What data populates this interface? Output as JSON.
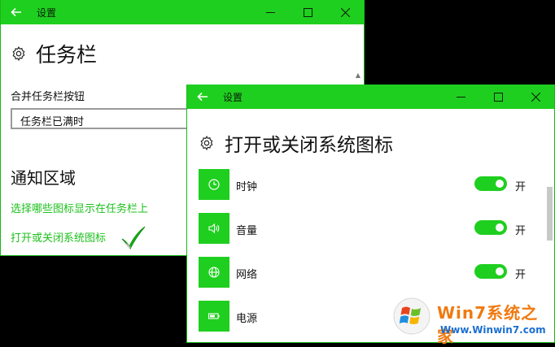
{
  "back_window": {
    "title": "设置",
    "heading": "任务栏",
    "combine_label": "合并任务栏按钮",
    "combine_value": "任务栏已满时",
    "notification_section": "通知区域",
    "link_select_icons": "选择哪些图标显示在任务栏上",
    "link_system_icons": "打开或关闭系统图标"
  },
  "front_window": {
    "title": "设置",
    "heading": "打开或关闭系统图标",
    "items": [
      {
        "label": "时钟",
        "icon": "clock-icon",
        "state": "开",
        "on": true
      },
      {
        "label": "音量",
        "icon": "volume-icon",
        "state": "开",
        "on": true
      },
      {
        "label": "网络",
        "icon": "network-icon",
        "state": "开",
        "on": true
      },
      {
        "label": "电源",
        "icon": "battery-icon"
      }
    ]
  },
  "watermark": {
    "brand": "Win7系统之家",
    "url": "Www.Winwin7.com"
  },
  "colors": {
    "accent": "#1fcf1f",
    "link": "#1cc11c",
    "watermark_brand": "#f07a10",
    "watermark_url": "#1b6fd1"
  }
}
